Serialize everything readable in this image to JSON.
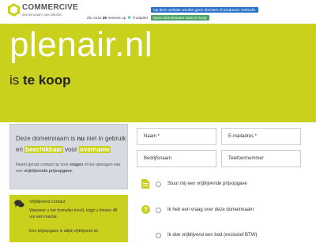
{
  "header": {
    "brand": "COMMERCIVE",
    "brand_sub": "domeinnaam specialisten",
    "reviews_prefix": "Zie onze",
    "reviews_count": "36",
    "reviews_suffix": "reviews op",
    "trustpilot": "Trustpilot",
    "badge_notice": "Op deze website worden geen diensten of producten verkocht.",
    "badge_forsale": "Deze domeinnaam staat te koop"
  },
  "hero": {
    "domain": "plenair.nl",
    "forsale_prefix": "is",
    "forsale_bold": "te koop"
  },
  "info": {
    "line1_a": "Deze domeinnaam is",
    "line1_b": "nu",
    "line1_c": "niet in gebruik",
    "line2_a": "en",
    "line2_hl1": "beschikbaar",
    "line2_b": "voor",
    "line2_hl2": "overname",
    "desc_a": "Neem gerust contact op voor",
    "desc_b": "vragen",
    "desc_c": "of het opvragen van een",
    "desc_d": "vrijblijvende prijsopgave."
  },
  "contact": {
    "title": "Vrijblijvend contact",
    "text": "Wanneer u het formulier invult, krijgt u binnen 48 uur een reactie.",
    "text2": "Een prijsopgave is altijd vrijblijvend en"
  },
  "form": {
    "name": "Naam *",
    "email": "E-mailadres *",
    "company": "Bedrijfsnaam",
    "phone": "Telefoonnummer",
    "option1": "Stuur mij een vrijblijvende prijsopgave",
    "option2": "Ik heb een vraag over deze domeinnaam",
    "option3": "Ik doe vrijblijvend een bod (exclusief BTW)"
  },
  "colors": {
    "accent": "#c9d11d",
    "card_gray": "#d7dae0",
    "badge_blue": "#2a73c9",
    "badge_green": "#4aa564",
    "trustpilot_green": "#00b67a"
  }
}
